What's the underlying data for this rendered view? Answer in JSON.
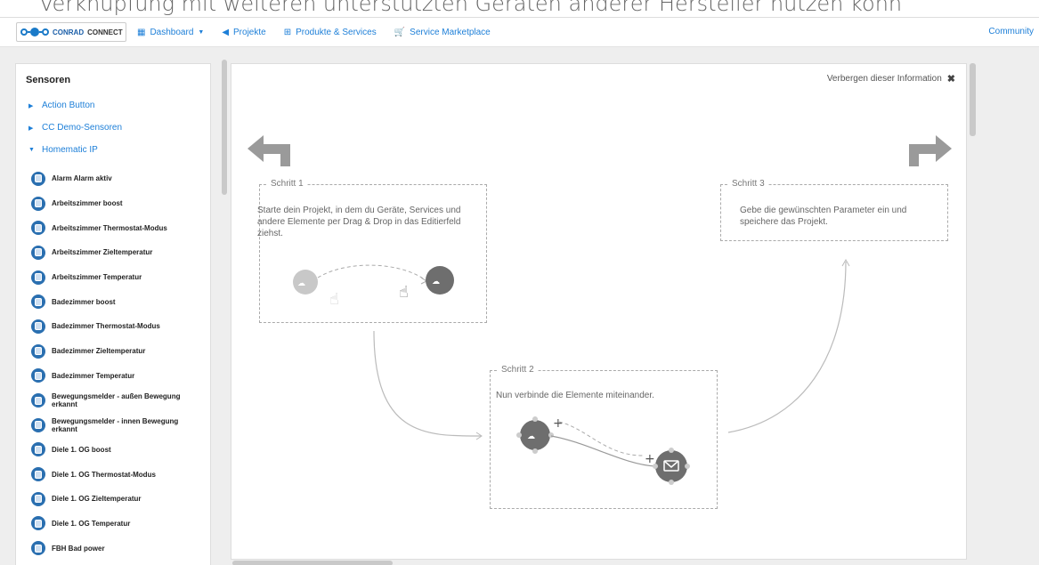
{
  "caption": "Verknüpfung mit weiteren unterstützten Geräten anderer Hersteller nutzen könn",
  "brand": {
    "part1": "CONRAD",
    "part2": "CONNECT"
  },
  "nav": {
    "dashboard": "Dashboard",
    "projekte": "Projekte",
    "produkte": "Produkte & Services",
    "marketplace": "Service Marketplace",
    "community": "Community"
  },
  "sidebar": {
    "title": "Sensoren",
    "categories": [
      {
        "label": "Action Button",
        "expanded": false
      },
      {
        "label": "CC Demo-Sensoren",
        "expanded": false
      },
      {
        "label": "Homematic IP",
        "expanded": true
      }
    ],
    "items": [
      "Alarm Alarm aktiv",
      "Arbeitszimmer boost",
      "Arbeitszimmer Thermostat-Modus",
      "Arbeitszimmer Zieltemperatur",
      "Arbeitszimmer Temperatur",
      "Badezimmer boost",
      "Badezimmer Thermostat-Modus",
      "Badezimmer Zieltemperatur",
      "Badezimmer Temperatur",
      "Bewegungsmelder - außen Bewegung erkannt",
      "Bewegungsmelder - innen Bewegung erkannt",
      "Diele 1. OG boost",
      "Diele 1. OG Thermostat-Modus",
      "Diele 1. OG Zieltemperatur",
      "Diele 1. OG Temperatur",
      "FBH Bad power"
    ]
  },
  "info": {
    "hide_label": "Verbergen dieser Information",
    "step1": {
      "title": "Schritt 1",
      "text": "Starte dein Projekt, in dem du Geräte, Services und andere Elemente per Drag & Drop in das Editierfeld ziehst."
    },
    "step2": {
      "title": "Schritt 2",
      "text": "Nun verbinde die Elemente miteinander."
    },
    "step3": {
      "title": "Schritt 3",
      "text": "Gebe die gewünschten Parameter ein und speichere das Projekt."
    }
  },
  "colors": {
    "link": "#1d7fd8",
    "device_icon": "#2a6fb0",
    "workspace": "#eeeeee"
  }
}
